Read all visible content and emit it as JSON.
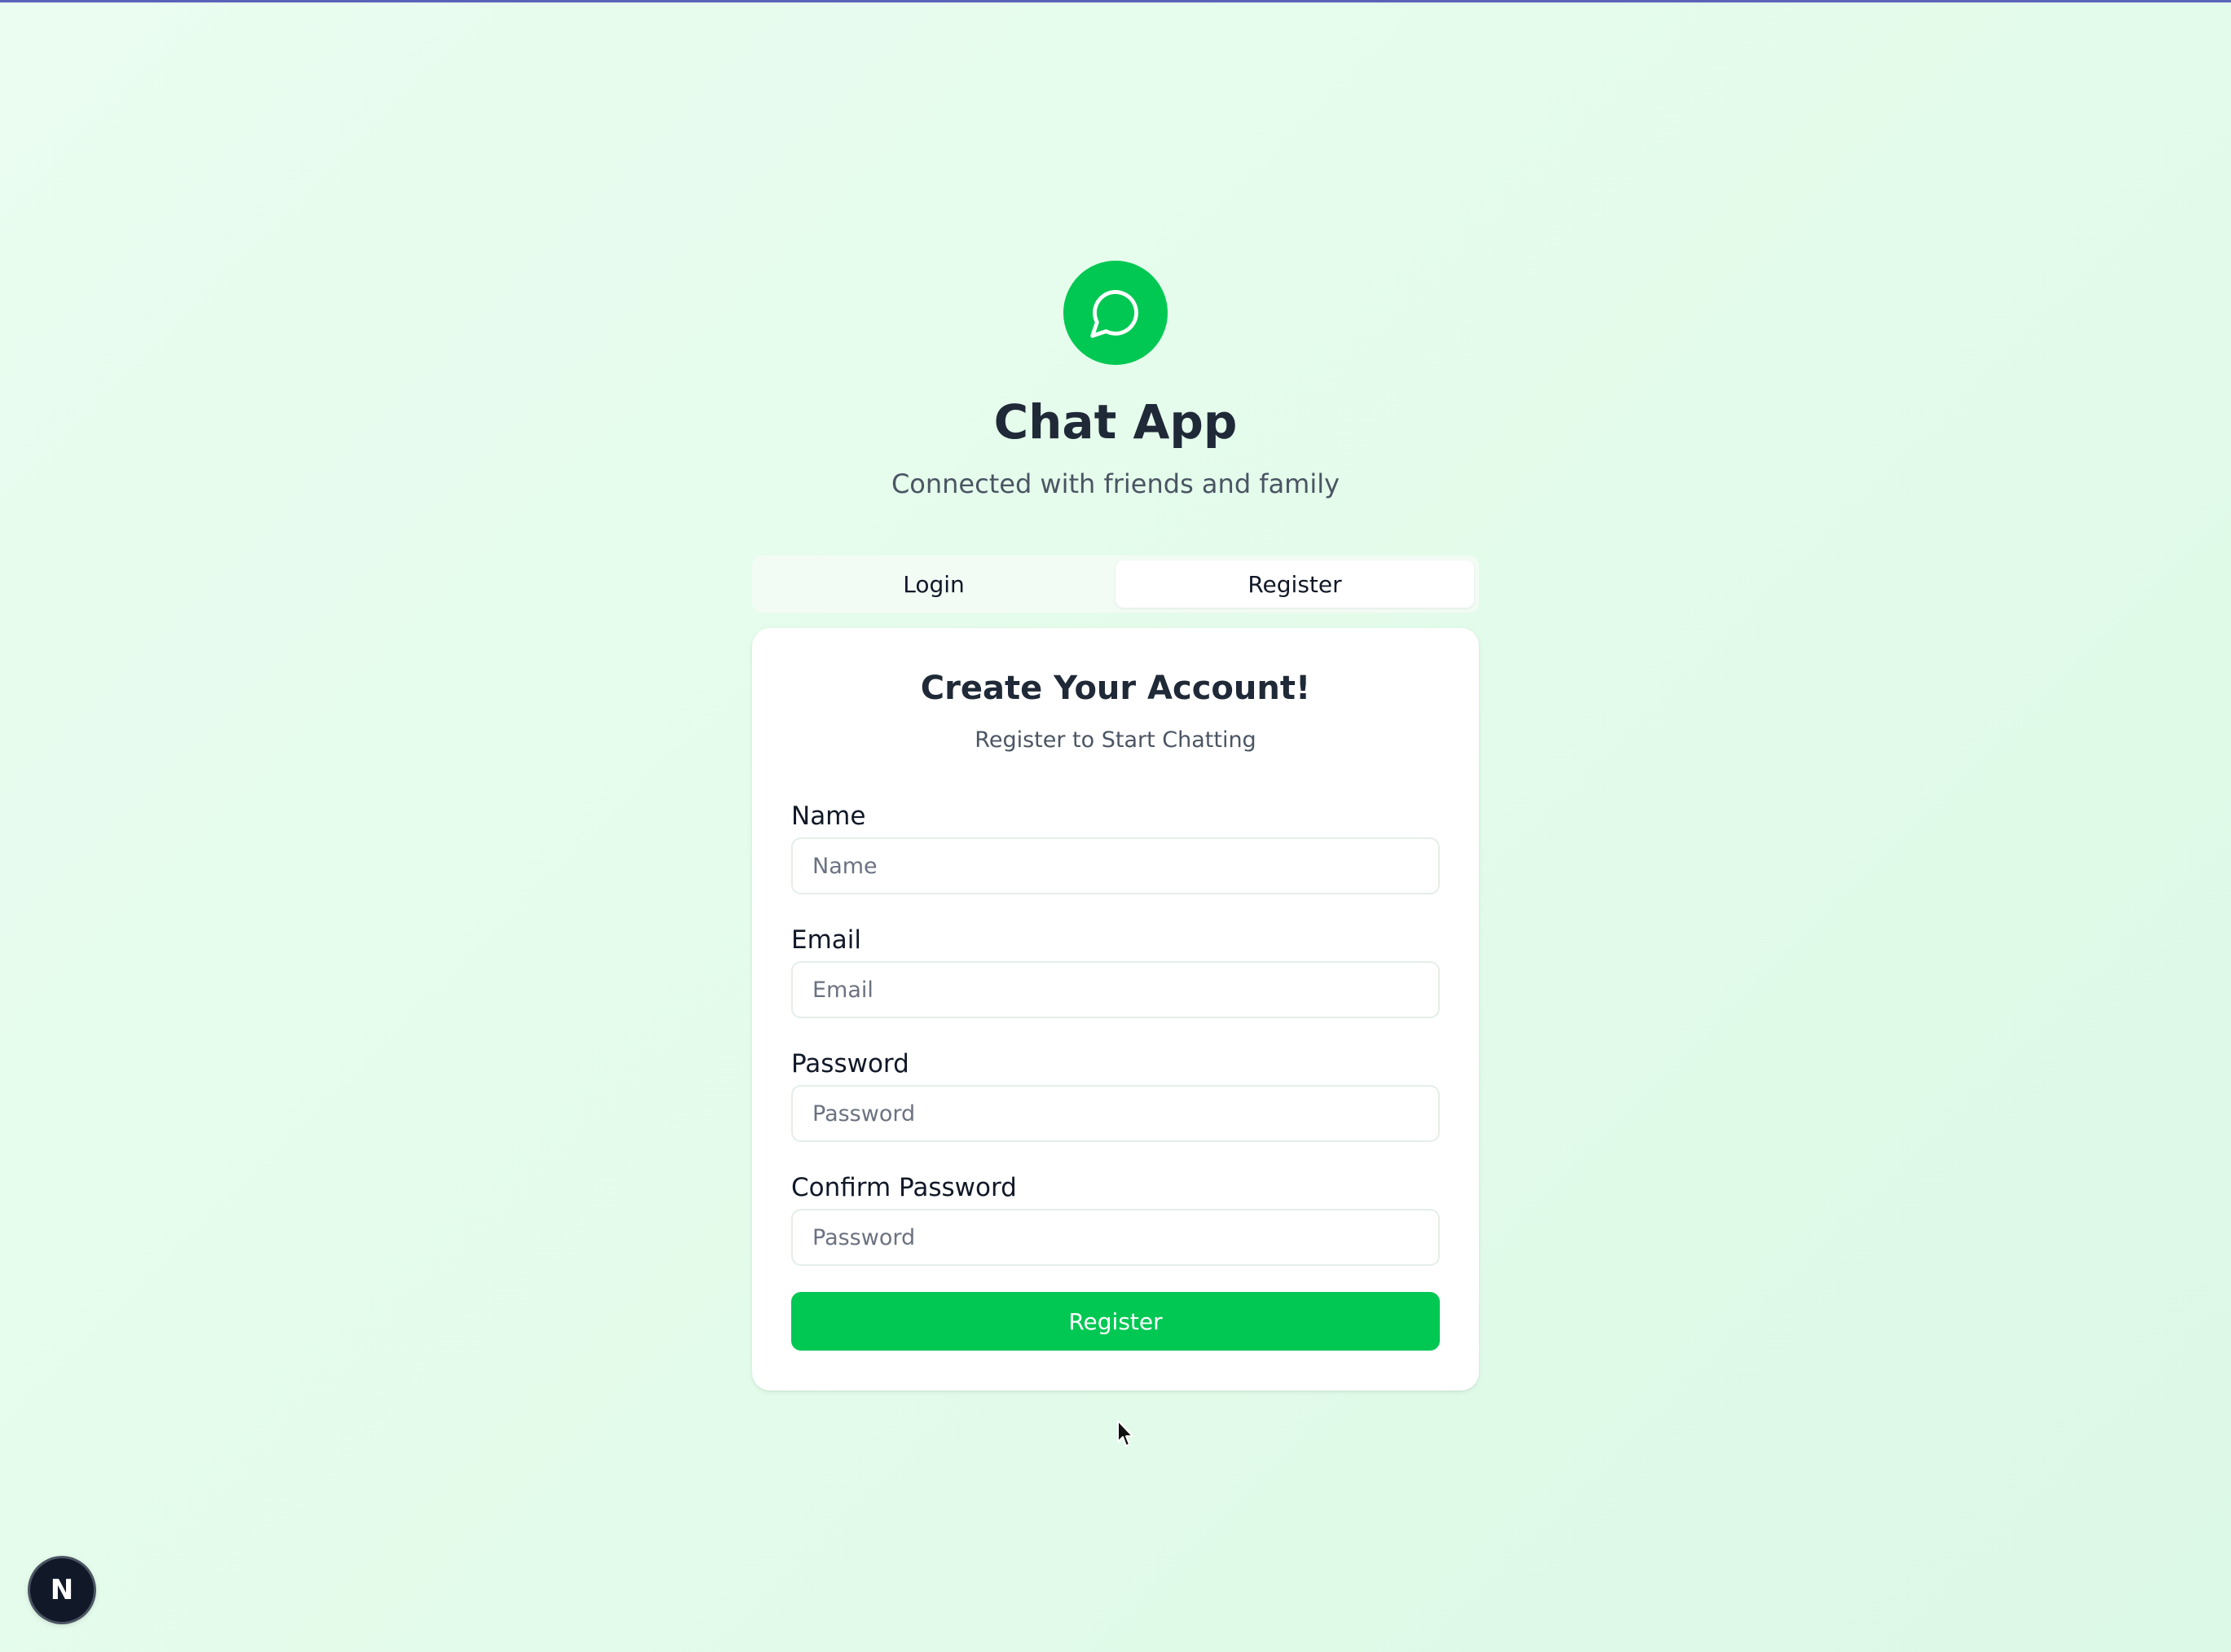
{
  "app": {
    "title": "Chat App",
    "subtitle": "Connected with friends and family",
    "logo_icon": "chat-bubble-icon"
  },
  "tabs": [
    {
      "label": "Login",
      "active": false
    },
    {
      "label": "Register",
      "active": true
    }
  ],
  "form": {
    "title": "Create Your Account!",
    "subtitle": "Register to Start Chatting",
    "fields": [
      {
        "label": "Name",
        "placeholder": "Name",
        "value": ""
      },
      {
        "label": "Email",
        "placeholder": "Email",
        "value": ""
      },
      {
        "label": "Password",
        "placeholder": "Password",
        "value": ""
      },
      {
        "label": "Confirm Password",
        "placeholder": "Password",
        "value": ""
      }
    ],
    "submit_label": "Register"
  },
  "dev_badge": {
    "label": "N",
    "icon": "nextjs-icon"
  },
  "colors": {
    "accent": "#00c853",
    "background": "#e6fbed",
    "card": "#ffffff",
    "title_text": "#1f2937",
    "muted_text": "#4b5563"
  }
}
